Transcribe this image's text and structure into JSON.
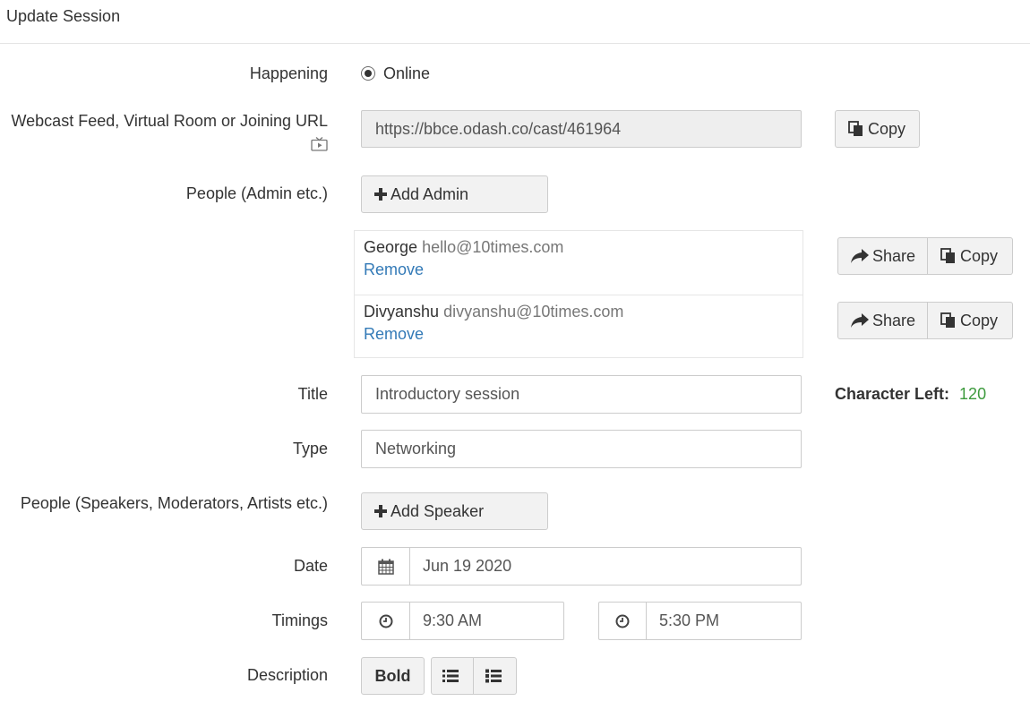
{
  "header": {
    "title": "Update Session"
  },
  "happening": {
    "label": "Happening",
    "option": "Online"
  },
  "webcast": {
    "label": "Webcast Feed, Virtual Room or Joining URL",
    "url": "https://bbce.odash.co/cast/461964",
    "copy_label": "Copy"
  },
  "admins": {
    "label": "People (Admin etc.)",
    "add_label": "Add Admin",
    "people": [
      {
        "name": "George",
        "email": "hello@10times.com",
        "remove": "Remove",
        "share": "Share",
        "copy": "Copy"
      },
      {
        "name": "Divyanshu",
        "email": "divyanshu@10times.com",
        "remove": "Remove",
        "share": "Share",
        "copy": "Copy"
      }
    ]
  },
  "title": {
    "label": "Title",
    "value": "Introductory session",
    "char_left_label": "Character Left:",
    "char_left_value": "120"
  },
  "type": {
    "label": "Type",
    "value": "Networking"
  },
  "speakers": {
    "label": "People (Speakers, Moderators, Artists etc.)",
    "add_label": "Add Speaker"
  },
  "date": {
    "label": "Date",
    "value": "Jun 19 2020"
  },
  "timings": {
    "label": "Timings",
    "start": "9:30 AM",
    "end": "5:30 PM"
  },
  "description": {
    "label": "Description",
    "bold_label": "Bold"
  },
  "colors": {
    "link": "#337ab7",
    "char_left": "#3c9a3c",
    "border": "#cccccc",
    "button_bg": "#f2f2f2"
  },
  "icons": [
    "tv-play-icon",
    "copy-icon",
    "plus-icon",
    "share-icon",
    "calendar-icon",
    "clock-icon",
    "list-icon",
    "list-icon-alt"
  ]
}
